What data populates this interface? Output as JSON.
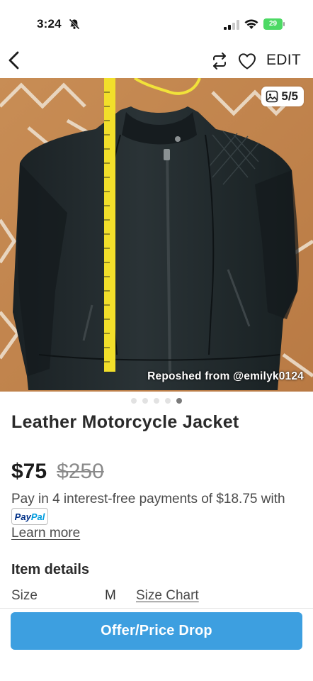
{
  "status_bar": {
    "time": "3:24",
    "battery": "29",
    "icons": [
      "bell-muted-icon",
      "signal-icon",
      "wifi-icon",
      "battery-icon"
    ]
  },
  "nav": {
    "edit_label": "EDIT",
    "icons": [
      "back-chevron-icon",
      "repost-icon",
      "heart-icon"
    ]
  },
  "photo": {
    "counter": "5/5",
    "credit": "Reposhed from @emilyk0124",
    "slides": 5,
    "active_slide": 5
  },
  "listing": {
    "title": "Leather Motorcycle Jacket",
    "price": "$75",
    "original_price": "$250",
    "installments_text": "Pay in 4 interest-free payments of $18.75 with",
    "paypal_pay": "Pay",
    "paypal_pal": "Pal",
    "learn_more": "Learn more"
  },
  "details": {
    "heading": "Item details",
    "size_label": "Size",
    "size_value": "M",
    "size_chart": "Size Chart"
  },
  "actions": {
    "offer_label": "Offer/Price Drop"
  },
  "colors": {
    "accent": "#3d9fe0",
    "battery": "#4cd964",
    "jacket": "#20272a",
    "background": "#c4894f",
    "tape": "#f2df2a"
  }
}
